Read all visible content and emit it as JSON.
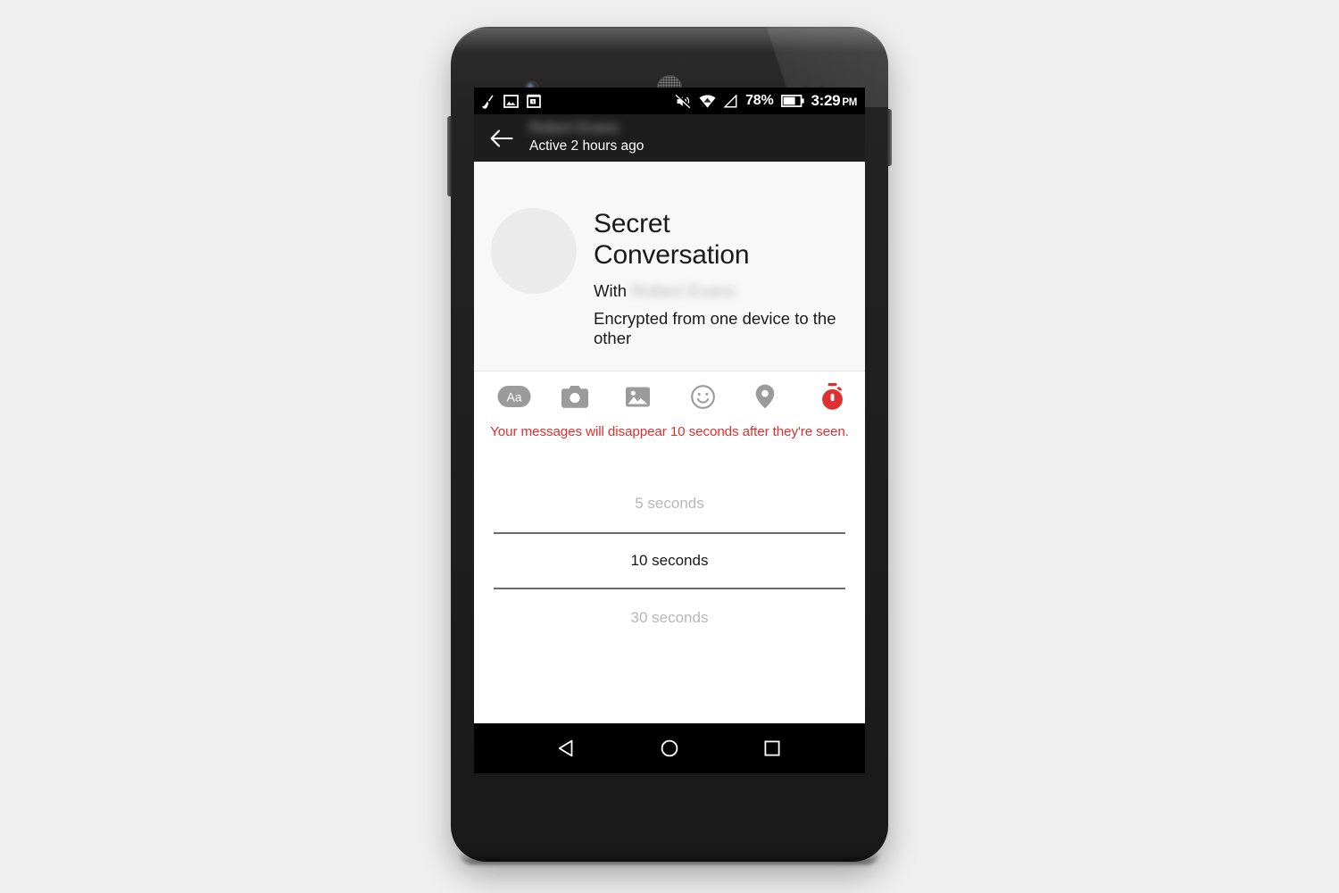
{
  "device": {
    "name": "android-smartphone",
    "front_camera": "front-camera",
    "earpiece": "earpiece-speaker"
  },
  "status_bar": {
    "left_icons": [
      "broom-icon",
      "screenshot-image-icon",
      "calendar-icon"
    ],
    "right_icons": [
      "volume-mute-icon",
      "wifi-icon",
      "cellular-signal-icon"
    ],
    "battery_percent": "78%",
    "battery_icon": "battery-icon",
    "time": "3:29",
    "meridiem": "PM"
  },
  "header": {
    "back_icon": "back-arrow-icon",
    "contact_name": "Robert Evans",
    "subtitle": "Active 2 hours ago"
  },
  "profile": {
    "avatar": "contact-avatar",
    "title": "Secret Conversation",
    "with_label": "With",
    "with_name": "Robert Evans",
    "encryption_note": "Encrypted from one device to the other"
  },
  "composer": {
    "tools": [
      {
        "name": "text-format-button",
        "icon": "aa-text-icon",
        "label": "Aa"
      },
      {
        "name": "camera-button",
        "icon": "camera-icon"
      },
      {
        "name": "photo-gallery-button",
        "icon": "image-icon"
      },
      {
        "name": "sticker-emoji-button",
        "icon": "smiley-icon"
      },
      {
        "name": "location-button",
        "icon": "location-pin-icon"
      },
      {
        "name": "disappearing-timer-button",
        "icon": "stopwatch-icon",
        "active": true
      }
    ]
  },
  "notice": {
    "text": "Your messages will disappear 10 seconds after they're seen."
  },
  "timer_picker": {
    "options": [
      {
        "label": "5 seconds",
        "selected": false
      },
      {
        "label": "10 seconds",
        "selected": true
      },
      {
        "label": "30 seconds",
        "selected": false
      }
    ]
  },
  "nav_bar": {
    "buttons": [
      {
        "name": "nav-back-button",
        "icon": "triangle-back-icon"
      },
      {
        "name": "nav-home-button",
        "icon": "circle-home-icon"
      },
      {
        "name": "nav-recents-button",
        "icon": "square-recents-icon"
      }
    ]
  },
  "colors": {
    "accent_red": "#DE3030",
    "toolbar_grey": "#9b9b9b",
    "status_bar_bg": "#000000",
    "header_bg": "#1d1d1d",
    "profile_bg": "#f8f8f8",
    "avatar_fill": "#ebebeb",
    "selected_text": "#171717",
    "unselected_text": "#b7b7b7",
    "divider": "#6c6c6c"
  }
}
